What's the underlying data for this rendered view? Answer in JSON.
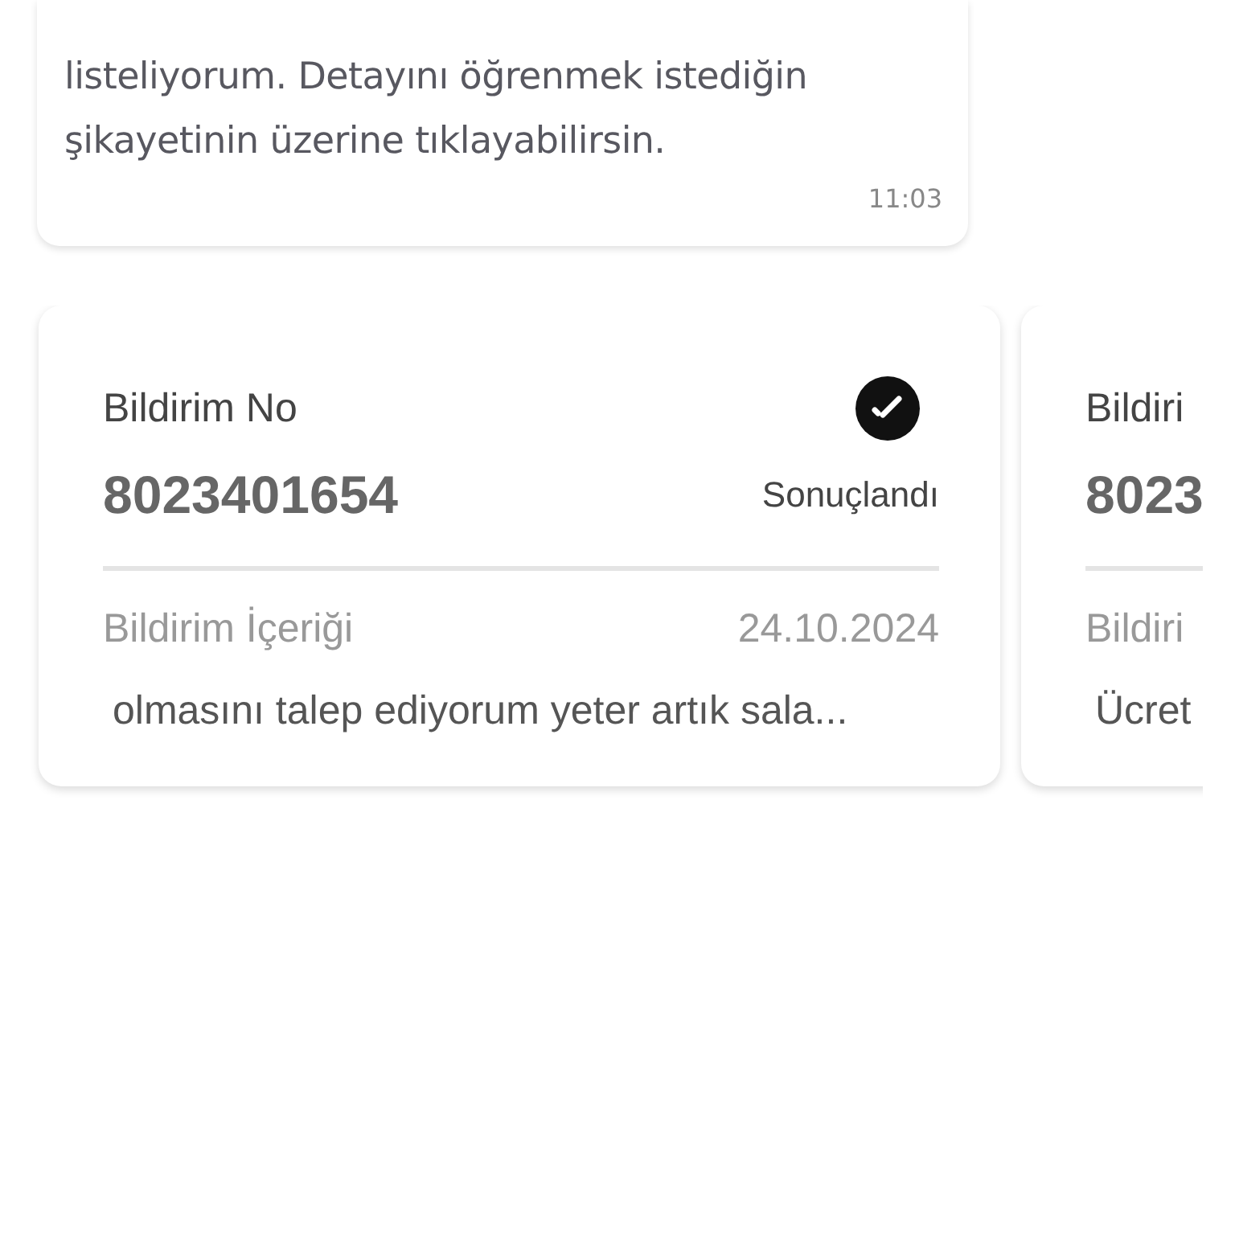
{
  "message": {
    "lines": [
      "listeliyorum. Detayını öğrenmek istediğin",
      "şikayetinin üzerine tıklayabilirsin."
    ],
    "time": "11:03"
  },
  "cards": [
    {
      "label": "Bildirim No",
      "number": "8023401654",
      "status": "Sonuçlandı",
      "completed": true,
      "content_label": "Bildirim İçeriği",
      "date": "24.10.2024",
      "content": "olmasını talep ediyorum yeter artık sala..."
    },
    {
      "label": "Bildiri",
      "number": "8023",
      "content_label": "Bildiri",
      "content": "Ücret"
    }
  ]
}
